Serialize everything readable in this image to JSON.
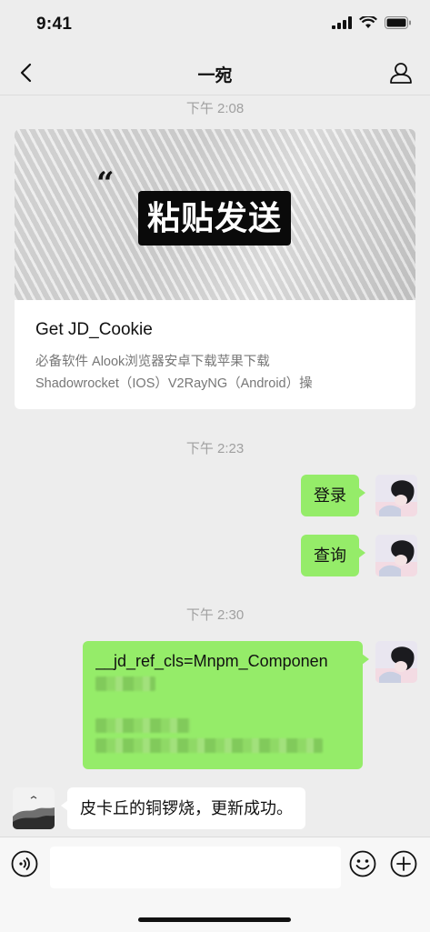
{
  "status_bar": {
    "time": "9:41"
  },
  "nav": {
    "title": "一宛"
  },
  "timestamps": [
    "下午 2:08",
    "下午 2:23",
    "下午 2:30"
  ],
  "link_card": {
    "banner_text": "粘贴发送",
    "quote_mark": "“",
    "title": "Get JD_Cookie",
    "description_line1": "必备软件 Alook浏览器安卓下载苹果下载",
    "description_line2": "Shadowrocket（IOS）V2RayNG（Android）操"
  },
  "messages": {
    "login": "登录",
    "query": "查询",
    "cookie_text": "__jd_ref_cls=Mnpm_Componen",
    "reply": "皮卡丘的铜锣烧，更新成功。"
  },
  "colors": {
    "sent_bubble": "#95ec69",
    "background": "#ededed"
  },
  "icons": [
    "back-icon",
    "profile-icon",
    "voice-icon",
    "emoji-icon",
    "plus-icon"
  ]
}
